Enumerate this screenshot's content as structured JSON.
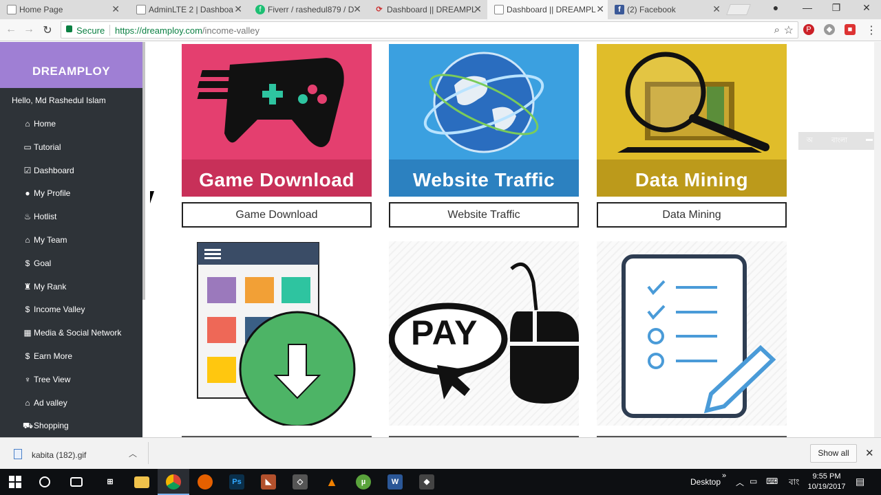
{
  "browser": {
    "tabs": [
      {
        "title": "Home Page",
        "favicon": "page-icon",
        "active": false
      },
      {
        "title": "AdminLTE 2 | Dashboa",
        "favicon": "page-icon",
        "active": false
      },
      {
        "title": "Fiverr / rashedul879 / D",
        "favicon": "fiverr-icon",
        "active": false
      },
      {
        "title": "Dashboard || DREAMPL",
        "favicon": "dreamploy-icon",
        "active": false
      },
      {
        "title": "Dashboard || DREAMPL",
        "favicon": "page-icon",
        "active": true
      },
      {
        "title": "(2) Facebook",
        "favicon": "facebook-icon",
        "active": false
      }
    ],
    "secure_label": "Secure",
    "url_host": "https://dreamploy.com",
    "url_path": "/income-valley"
  },
  "sidebar": {
    "brand": "DREAMPLOY",
    "greeting": "Hello, Md Rashedul Islam",
    "items": [
      {
        "label": "Home",
        "icon": "home-icon",
        "glyph": "⌂"
      },
      {
        "label": "Tutorial",
        "icon": "monitor-icon",
        "glyph": "▭"
      },
      {
        "label": "Dashboard",
        "icon": "check-square-icon",
        "glyph": "☑"
      },
      {
        "label": "My Profile",
        "icon": "user-icon",
        "glyph": "●"
      },
      {
        "label": "Hotlist",
        "icon": "fire-icon",
        "glyph": "♨"
      },
      {
        "label": "My Team",
        "icon": "home-icon",
        "glyph": "⌂"
      },
      {
        "label": "Goal",
        "icon": "dollar-icon",
        "glyph": "$"
      },
      {
        "label": "My Rank",
        "icon": "rank-icon",
        "glyph": "♜"
      },
      {
        "label": "Income Valley",
        "icon": "dollar-icon",
        "glyph": "$"
      },
      {
        "label": "Media & Social Network",
        "icon": "media-icon",
        "glyph": "▦"
      },
      {
        "label": "Earn More",
        "icon": "dollar-icon",
        "glyph": "$"
      },
      {
        "label": "Tree View",
        "icon": "tree-icon",
        "glyph": "♆"
      },
      {
        "label": "Ad valley",
        "icon": "home-icon",
        "glyph": "⌂"
      },
      {
        "label": "Shopping",
        "icon": "cart-icon",
        "glyph": "⛟"
      }
    ]
  },
  "cards": [
    {
      "image_title": "Game Download",
      "button_label": "Game Download",
      "bg": "#e43f6f"
    },
    {
      "image_title": "Website Traffic",
      "button_label": "Website Traffic",
      "bg": "#3ba0e0"
    },
    {
      "image_title": "Data Mining",
      "button_label": "Data Mining",
      "bg": "#e0bd2a"
    }
  ],
  "pay_text": "PAY",
  "download_shelf": {
    "file_name": "kabita (182).gif",
    "show_all_label": "Show all"
  },
  "language_widget": "বাংলা",
  "taskbar": {
    "desktop_label": "Desktop",
    "lang": "বাং",
    "time": "9:55 PM",
    "date": "10/19/2017"
  }
}
